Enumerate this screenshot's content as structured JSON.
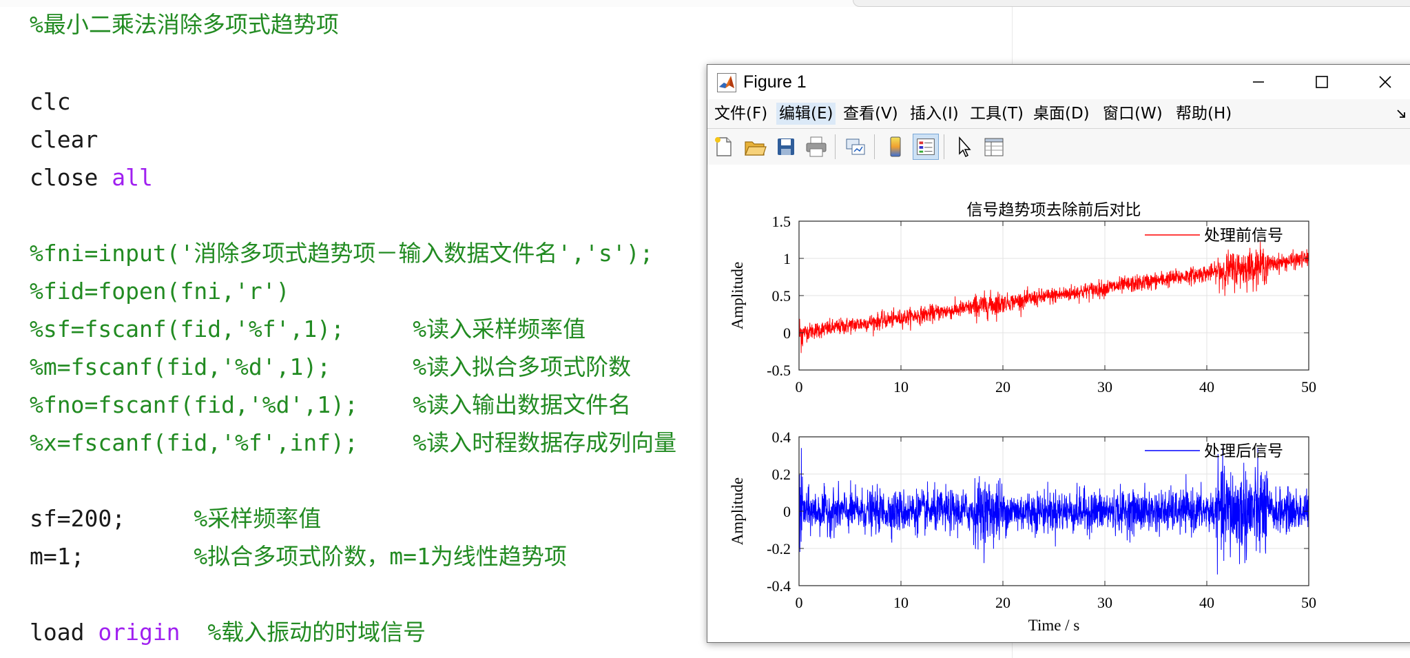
{
  "editor": {
    "lines": [
      {
        "top": 14,
        "parts": [
          {
            "t": "%最小二乘法消除多项式趋势项",
            "c": "c"
          }
        ]
      },
      {
        "top": 126,
        "parts": [
          {
            "t": "clc",
            "c": ""
          }
        ]
      },
      {
        "top": 181,
        "parts": [
          {
            "t": "clear",
            "c": ""
          }
        ]
      },
      {
        "top": 236,
        "parts": [
          {
            "t": "close ",
            "c": ""
          },
          {
            "t": "all",
            "c": "k"
          }
        ]
      },
      {
        "top": 346,
        "parts": [
          {
            "t": "%fni=input('消除多项式趋势项－输入数据文件名','s');",
            "c": "c"
          }
        ]
      },
      {
        "top": 401,
        "parts": [
          {
            "t": "%fid=fopen(fni,'r')",
            "c": "c"
          }
        ]
      },
      {
        "top": 456,
        "parts": [
          {
            "t": "%sf=fscanf(fid,'%f',1);     %读入采样频率值",
            "c": "c"
          }
        ]
      },
      {
        "top": 511,
        "parts": [
          {
            "t": "%m=fscanf(fid,'%d',1);      %读入拟合多项式阶数",
            "c": "c"
          }
        ]
      },
      {
        "top": 566,
        "parts": [
          {
            "t": "%fno=fscanf(fid,'%d',1);    %读入输出数据文件名",
            "c": "c"
          }
        ]
      },
      {
        "top": 621,
        "parts": [
          {
            "t": "%x=fscanf(fid,'%f',inf);    %读入时程数据存成列向量",
            "c": "c"
          }
        ]
      },
      {
        "top": 731,
        "parts": [
          {
            "t": "sf=200;     ",
            "c": ""
          },
          {
            "t": "%采样频率值",
            "c": "c"
          }
        ]
      },
      {
        "top": 786,
        "parts": [
          {
            "t": "m=1;        ",
            "c": ""
          },
          {
            "t": "%拟合多项式阶数，m=1为线性趋势项",
            "c": "c"
          }
        ]
      },
      {
        "top": 896,
        "parts": [
          {
            "t": "load ",
            "c": ""
          },
          {
            "t": "origin",
            "c": "k"
          },
          {
            "t": "  ",
            "c": ""
          },
          {
            "t": "%载入振动的时域信号",
            "c": "c"
          }
        ]
      }
    ]
  },
  "figure": {
    "title": "Figure 1",
    "menu": [
      {
        "label": "文件(F)",
        "name": "menu-file"
      },
      {
        "label": "编辑(E)",
        "name": "menu-edit",
        "active": true
      },
      {
        "label": "查看(V)",
        "name": "menu-view"
      },
      {
        "label": "插入(I)",
        "name": "menu-insert"
      },
      {
        "label": "工具(T)",
        "name": "menu-tools"
      },
      {
        "label": "桌面(D)",
        "name": "menu-desktop"
      },
      {
        "label": "窗口(W)",
        "name": "menu-window"
      },
      {
        "label": "帮助(H)",
        "name": "menu-help"
      }
    ],
    "toolbar": [
      "new-figure-icon",
      "open-file-icon",
      "save-icon",
      "print-icon",
      "link-plot-icon",
      "insert-colorbar-icon",
      "insert-legend-icon",
      "select-pointer-icon",
      "property-inspector-icon"
    ]
  },
  "chart_data": [
    {
      "type": "line",
      "title": "信号趋势项去除前后对比",
      "xlabel": "",
      "ylabel": "Amplitude",
      "xlim": [
        0,
        50
      ],
      "ylim": [
        -0.5,
        1.5
      ],
      "xticks": [
        0,
        10,
        20,
        30,
        40,
        50
      ],
      "yticks": [
        -0.5,
        0,
        0.5,
        1,
        1.5
      ],
      "grid": true,
      "legend": "top-right",
      "series": [
        {
          "name": "处理前信号",
          "color": "#ff0000",
          "trend_start": 0.0,
          "trend_end": 1.0,
          "noise_amplitude": 0.2
        }
      ]
    },
    {
      "type": "line",
      "title": "",
      "xlabel": "Time / s",
      "ylabel": "Amplitude",
      "xlim": [
        0,
        50
      ],
      "ylim": [
        -0.4,
        0.4
      ],
      "xticks": [
        0,
        10,
        20,
        30,
        40,
        50
      ],
      "yticks": [
        -0.4,
        -0.2,
        0,
        0.2,
        0.4
      ],
      "grid": true,
      "legend": "top-right",
      "series": [
        {
          "name": "处理后信号",
          "color": "#0000ff",
          "trend_start": 0.0,
          "trend_end": 0.0,
          "noise_amplitude": 0.2
        }
      ]
    }
  ]
}
